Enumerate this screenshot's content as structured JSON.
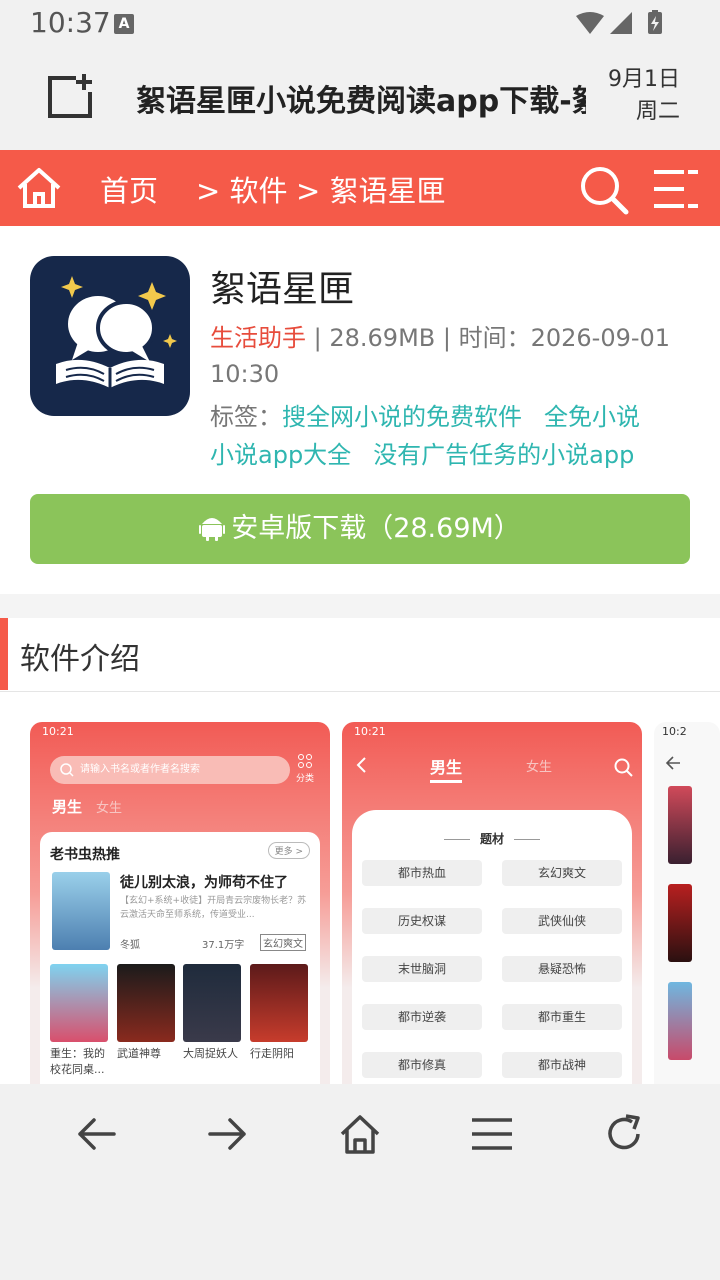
{
  "status": {
    "time": "10:37",
    "badge": "A"
  },
  "browser": {
    "page_title": "絮语星匣小说免费阅读app下载-絮",
    "date": "9月1日",
    "weekday": "周二"
  },
  "nav": {
    "home": "首页",
    "crumb1": "> 软件",
    "crumb2": "> 絮语星匣"
  },
  "app": {
    "name": "絮语星匣",
    "category": "生活助手",
    "size": "28.69MB",
    "time_label": "时间：",
    "time_value": "2026-09-01",
    "time_hour": "10:30",
    "tags_label": "标签：",
    "tags": [
      "搜全网小说的免费软件",
      "全免小说",
      "小说app大全",
      "没有广告任务的小说app"
    ],
    "download_label": "安卓版下载（28.69M）"
  },
  "intro": {
    "title": "软件介绍"
  },
  "shot1": {
    "time": "10:21",
    "search_placeholder": "请输入书名或者作者名搜索",
    "grid_label": "分类",
    "tab_on": "男生",
    "tab_off": "女生",
    "card_title": "老书虫热推",
    "more": "更多 >",
    "book_title": "徒儿别太浪，为师苟不住了",
    "book_desc": "【玄幻+系统+收徒】开局青云宗废物长老？苏云激活天命至师系统，传道受业...",
    "book_author": "冬狐",
    "book_words": "37.1万字",
    "book_genre": "玄幻爽文",
    "small_books": [
      "重生：我的校花同桌...",
      "武道神尊",
      "大周捉妖人",
      "行走阴阳"
    ]
  },
  "shot2": {
    "time": "10:21",
    "tab_on": "男生",
    "tab_off": "女生",
    "panel_title": "题材",
    "genres": [
      "都市热血",
      "玄幻爽文",
      "历史权谋",
      "武侠仙侠",
      "末世脑洞",
      "悬疑恐怖",
      "都市逆袭",
      "都市重生",
      "都市修真",
      "都市战神"
    ]
  },
  "shot3": {
    "time": "10:2"
  },
  "colors": {
    "accent": "#f55a49",
    "download": "#8bc45a",
    "tag": "#2fb6b0",
    "category": "#e74c3c"
  }
}
